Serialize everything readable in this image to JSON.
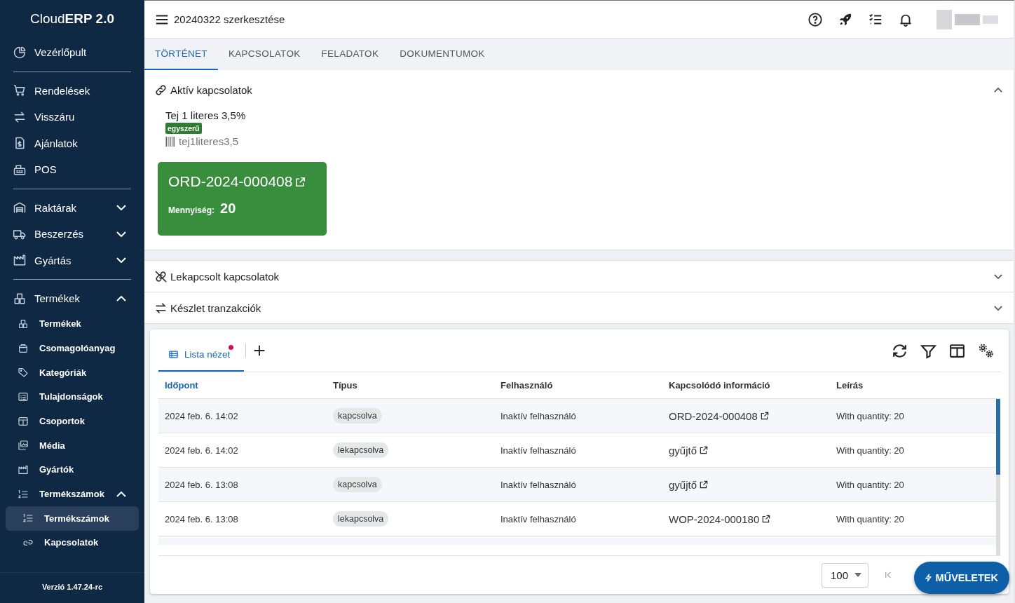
{
  "app": {
    "logo_plain": "Cloud",
    "logo_bold": "ERP 2.0",
    "version": "Verzió 1.47.24-rc"
  },
  "sidebar": {
    "groups": [
      [
        {
          "label": "Vezérlőpult"
        }
      ],
      [
        {
          "label": "Rendelések"
        },
        {
          "label": "Visszáru"
        },
        {
          "label": "Ajánlatok"
        },
        {
          "label": "POS"
        }
      ],
      [
        {
          "label": "Raktárak",
          "expanded": false
        },
        {
          "label": "Beszerzés",
          "expanded": false
        },
        {
          "label": "Gyártás",
          "expanded": false
        }
      ],
      [
        {
          "label": "Termékek",
          "expanded": true,
          "children": [
            {
              "label": "Termékek"
            },
            {
              "label": "Csomagolóanyag"
            },
            {
              "label": "Kategóriák"
            },
            {
              "label": "Tulajdonságok"
            },
            {
              "label": "Csoportok"
            },
            {
              "label": "Média"
            },
            {
              "label": "Gyártók"
            },
            {
              "label": "Termékszámok",
              "expanded": true,
              "children": [
                {
                  "label": "Termékszámok",
                  "selected": true
                },
                {
                  "label": "Kapcsolatok",
                  "selected": false
                }
              ]
            }
          ]
        }
      ]
    ]
  },
  "header": {
    "title": "20240322 szerkesztése"
  },
  "tabs": [
    {
      "label": "TÖRTÉNET",
      "selected": true
    },
    {
      "label": "KAPCSOLATOK",
      "selected": false
    },
    {
      "label": "FELADATOK",
      "selected": false
    },
    {
      "label": "DOKUMENTUMOK",
      "selected": false
    }
  ],
  "panels": [
    {
      "title": "Aktív kapcsolatok",
      "kind": "link",
      "expanded": true,
      "product": {
        "name": "Tej 1 literes 3,5%",
        "badge": "egyszerű",
        "code": "tej1literes3,5"
      },
      "orders": [
        {
          "number": "ORD-2024-000408",
          "quantity_label": "Mennyiség:",
          "quantity": "20"
        }
      ]
    },
    {
      "title": "Lekapcsolt kapcsolatok",
      "kind": "unlink",
      "expanded": false
    },
    {
      "title": "Készlet tranzakciók",
      "kind": "transfer",
      "expanded": false
    }
  ],
  "history": {
    "view_tab": {
      "label": "Lista nézet",
      "modified": true
    },
    "columns": [
      {
        "label": "Időpont",
        "sorted": true
      },
      {
        "label": "Típus",
        "sorted": false
      },
      {
        "label": "Felhasználó",
        "sorted": false
      },
      {
        "label": "Kapcsolódó információ",
        "sorted": false
      },
      {
        "label": "Leírás",
        "sorted": false
      }
    ],
    "rows": [
      {
        "time": "2024 feb. 6. 14:02",
        "type": "kapcsolva",
        "user": "Inaktív felhasználó",
        "related": "ORD-2024-000408",
        "description": "With quantity: 20"
      },
      {
        "time": "2024 feb. 6. 14:02",
        "type": "lekapcsolva",
        "user": "Inaktív felhasználó",
        "related": "gyűjtő",
        "description": "With quantity: 20"
      },
      {
        "time": "2024 feb. 6. 13:08",
        "type": "kapcsolva",
        "user": "Inaktív felhasználó",
        "related": "gyűjtő",
        "description": "With quantity: 20"
      },
      {
        "time": "2024 feb. 6. 13:08",
        "type": "lekapcsolva",
        "user": "Inaktív felhasználó",
        "related": "WOP-2024-000180",
        "description": "With quantity: 20"
      }
    ],
    "page_size": "100",
    "first_page_disabled": true
  },
  "fab": {
    "label": "MŰVELETEK"
  }
}
